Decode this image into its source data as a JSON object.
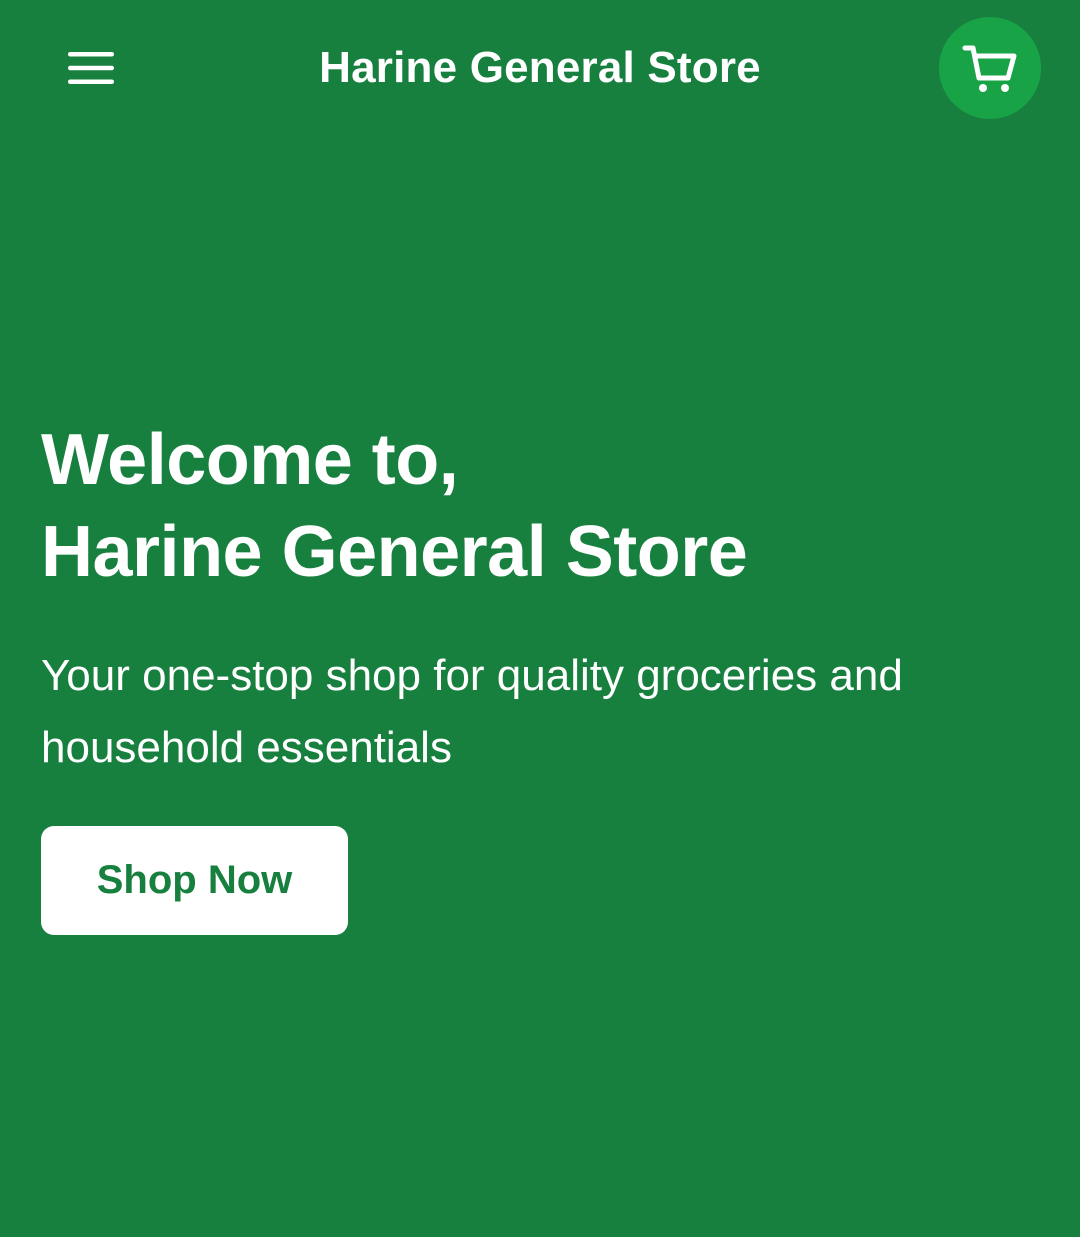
{
  "header": {
    "title": "Harine General Store",
    "menu_icon": "hamburger-menu-icon",
    "cart_icon": "shopping-cart-icon"
  },
  "hero": {
    "heading_line1": "Welcome to,",
    "heading_line2": "Harine General Store",
    "subtitle": "Your one-stop shop for quality groceries and household essentials",
    "cta_label": "Shop Now"
  },
  "colors": {
    "background": "#18803f",
    "cart_button": "#18a346",
    "text": "#ffffff",
    "cta_background": "#ffffff",
    "cta_text": "#18803f"
  }
}
